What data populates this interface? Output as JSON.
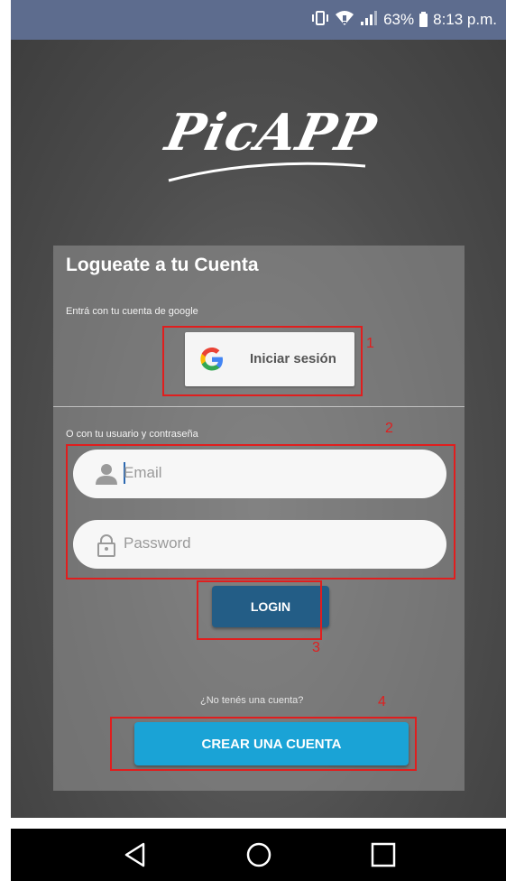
{
  "status_bar": {
    "battery": "63%",
    "time": "8:13 p.m."
  },
  "app": {
    "logo_text": "PicAPP"
  },
  "card": {
    "title": "Logueate a tu Cuenta",
    "google_hint": "Entrá con tu cuenta de google",
    "google_button_label": "Iniciar sesión",
    "credentials_hint": "O con tu usuario y contraseña",
    "email_placeholder": "Email",
    "password_placeholder": "Password",
    "login_label": "LOGIN",
    "no_account_text": "¿No tenés una cuenta?",
    "create_account_label": "CREAR UNA CUENTA"
  },
  "annotations": {
    "one": "1",
    "two": "2",
    "three": "3",
    "four": "4"
  },
  "colors": {
    "status_bar": "#5d6c8e",
    "login_button": "#235d86",
    "create_button": "#1aa3d6",
    "annotation": "#e01e1e"
  },
  "icons": {
    "status": [
      "vibrate-icon",
      "wifi-icon",
      "signal-icon",
      "battery-icon"
    ],
    "nav": [
      "back-icon",
      "home-icon",
      "recents-icon"
    ]
  }
}
